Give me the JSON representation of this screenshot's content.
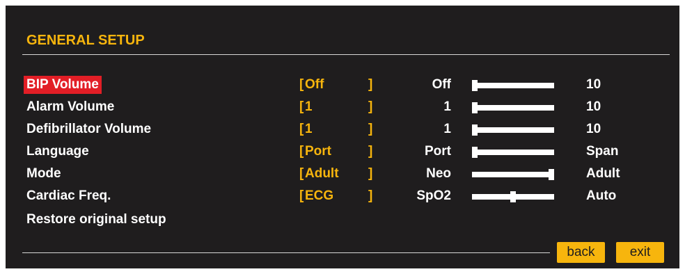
{
  "title": "GENERAL SETUP",
  "colors": {
    "background": "#1f1d1e",
    "accent": "#f7b50d",
    "selection": "#e21e26",
    "text": "#ffffff"
  },
  "rows": [
    {
      "label": "BIP Volume",
      "value": "Off",
      "bracket_open": "[",
      "bracket_close": "]",
      "min": "Off",
      "max": "10",
      "level": 0.0,
      "selected": true
    },
    {
      "label": "Alarm Volume",
      "value": "1",
      "bracket_open": "[",
      "bracket_close": "]",
      "min": "1",
      "max": "10",
      "level": 0.0,
      "selected": false
    },
    {
      "label": "Defibrillator Volume",
      "value": "1",
      "bracket_open": "[",
      "bracket_close": "]",
      "min": "1",
      "max": "10",
      "level": 0.0,
      "selected": false
    },
    {
      "label": "Language",
      "value": "Port",
      "bracket_open": "[",
      "bracket_close": "]",
      "min": "Port",
      "max": "Span",
      "level": 0.0,
      "selected": false
    },
    {
      "label": "Mode",
      "value": "Adult",
      "bracket_open": "[",
      "bracket_close": "]",
      "min": "Neo",
      "max": "Adult",
      "level": 1.0,
      "selected": false
    },
    {
      "label": "Cardiac Freq.",
      "value": "ECG",
      "bracket_open": "[",
      "bracket_close": "]",
      "min": "SpO2",
      "max": "Auto",
      "level": 0.5,
      "selected": false
    }
  ],
  "restore_label": "Restore original setup",
  "buttons": {
    "back": "back",
    "exit": "exit"
  }
}
